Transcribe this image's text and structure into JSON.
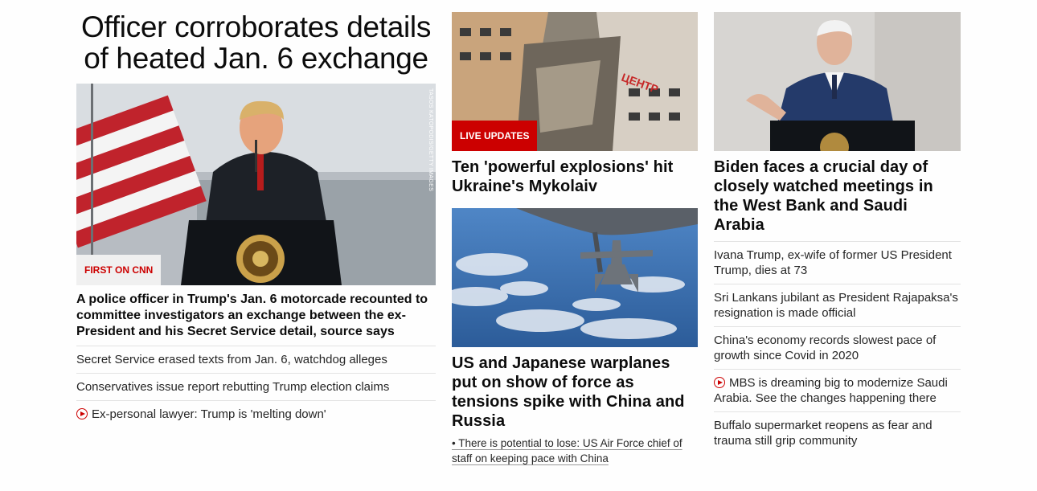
{
  "col1": {
    "banner": "Officer corroborates details of heated Jan. 6 exchange",
    "hero_badge": "FIRST ON CNN",
    "hero_credit": "TASOS KATOPODIS/GETTY IMAGES",
    "lead": "A police officer in Trump's Jan. 6 motorcade recounted to committee investigators an exchange between the ex-President and his Secret Service detail, source says",
    "items": [
      {
        "text": "Secret Service erased texts from Jan. 6, watchdog alleges",
        "video": false
      },
      {
        "text": "Conservatives issue report rebutting Trump election claims",
        "video": false
      },
      {
        "text": "Ex-personal lawyer: Trump is 'melting down'",
        "video": true
      }
    ]
  },
  "col2": {
    "story1": {
      "badge": "LIVE UPDATES",
      "headline": "Ten 'powerful explosions' hit Ukraine's Mykolaiv"
    },
    "story2": {
      "headline": "US and Japanese warplanes put on show of force as tensions spike with China and Russia",
      "sub": "• There is potential to lose: US Air Force chief of staff on keeping pace with China"
    }
  },
  "col3": {
    "headline": "Biden faces a crucial day of closely watched meetings in the West Bank and Saudi Arabia",
    "items": [
      {
        "text": "Ivana Trump, ex-wife of former US President Trump, dies at 73",
        "video": false
      },
      {
        "text": "Sri Lankans jubilant as President Rajapaksa's resignation is made official",
        "video": false
      },
      {
        "text": "China's economy records slowest pace of growth since Covid in 2020",
        "video": false
      },
      {
        "text": "MBS is dreaming big to modernize Saudi Arabia. See the changes happening there",
        "video": true
      },
      {
        "text": "Buffalo supermarket reopens as fear and trauma still grip community",
        "video": false
      }
    ]
  },
  "colors": {
    "accent": "#cc0000",
    "text": "#0c0c0c",
    "divider": "#e3e3e3"
  }
}
